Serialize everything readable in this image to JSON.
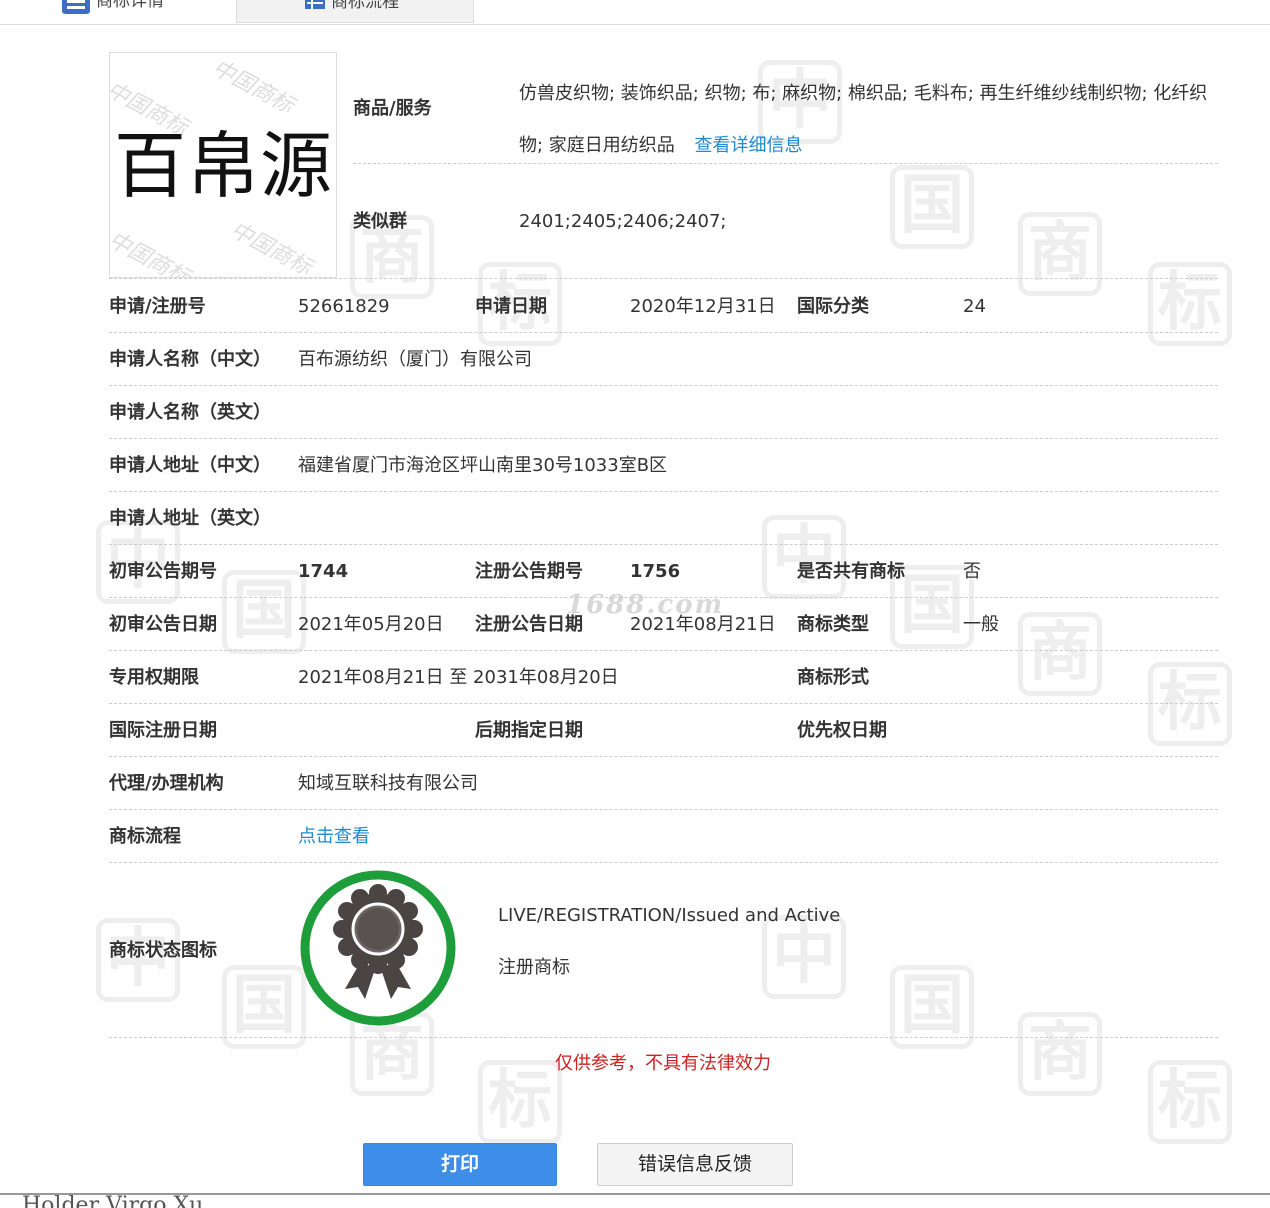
{
  "tabs": [
    {
      "label": "商标详情",
      "icon": "list-icon"
    },
    {
      "label": "商标流程",
      "icon": "grid-icon"
    }
  ],
  "watermark": {
    "chars": [
      "中",
      "国",
      "商",
      "标"
    ],
    "logo_watermark": "中国商标",
    "site": "1688.com"
  },
  "logo": {
    "text": "百帛源"
  },
  "goods": {
    "label": "商品/服务",
    "text": "仿兽皮织物; 装饰织品; 织物; 布; 麻织物; 棉织品; 毛料布; 再生纤维纱线制织物; 化纤织物; 家庭日用纺织品",
    "link": "查看详细信息"
  },
  "similar_group": {
    "label": "类似群",
    "value": "2401;2405;2406;2407;"
  },
  "fields": {
    "reg_no": {
      "label": "申请/注册号",
      "value": "52661829"
    },
    "apply_date": {
      "label": "申请日期",
      "value": "2020年12月31日"
    },
    "intl_class": {
      "label": "国际分类",
      "value": "24"
    },
    "applicant_cn": {
      "label": "申请人名称（中文）",
      "value": "百布源纺织（厦门）有限公司"
    },
    "applicant_en": {
      "label": "申请人名称（英文）",
      "value": ""
    },
    "address_cn": {
      "label": "申请人地址（中文）",
      "value": "福建省厦门市海沧区坪山南里30号1033室B区"
    },
    "address_en": {
      "label": "申请人地址（英文）",
      "value": ""
    },
    "prelim_no": {
      "label": "初审公告期号",
      "value": "1744"
    },
    "reg_pub_no": {
      "label": "注册公告期号",
      "value": "1756"
    },
    "shared_mark": {
      "label": "是否共有商标",
      "value": "否"
    },
    "prelim_date": {
      "label": "初审公告日期",
      "value": "2021年05月20日"
    },
    "reg_pub_date": {
      "label": "注册公告日期",
      "value": "2021年08月21日"
    },
    "mark_type": {
      "label": "商标类型",
      "value": "一般"
    },
    "exclusive_period": {
      "label": "专用权期限",
      "value": "2021年08月21日 至 2031年08月20日"
    },
    "mark_form": {
      "label": "商标形式",
      "value": ""
    },
    "intl_reg_date": {
      "label": "国际注册日期",
      "value": ""
    },
    "later_designation": {
      "label": "后期指定日期",
      "value": ""
    },
    "priority_date": {
      "label": "优先权日期",
      "value": ""
    },
    "agent": {
      "label": "代理/办理机构",
      "value": "知域互联科技有限公司"
    },
    "process": {
      "label": "商标流程",
      "link": "点击查看"
    }
  },
  "status": {
    "label": "商标状态图标",
    "icon": "award-ribbon-icon",
    "text_en": "LIVE/REGISTRATION/Issued and Active",
    "text_cn": "注册商标"
  },
  "disclaimer": "仅供参考，不具有法律效力",
  "buttons": {
    "print": "打印",
    "feedback": "错误信息反馈"
  },
  "bottom_peek": "Holder Virgo Xu",
  "colors": {
    "link": "#1e8bd0",
    "disclaimer": "#cc2222",
    "print_button": "#3d8ee8",
    "badge_ring": "#1e9e3a",
    "badge_medal": "#4a4442"
  }
}
